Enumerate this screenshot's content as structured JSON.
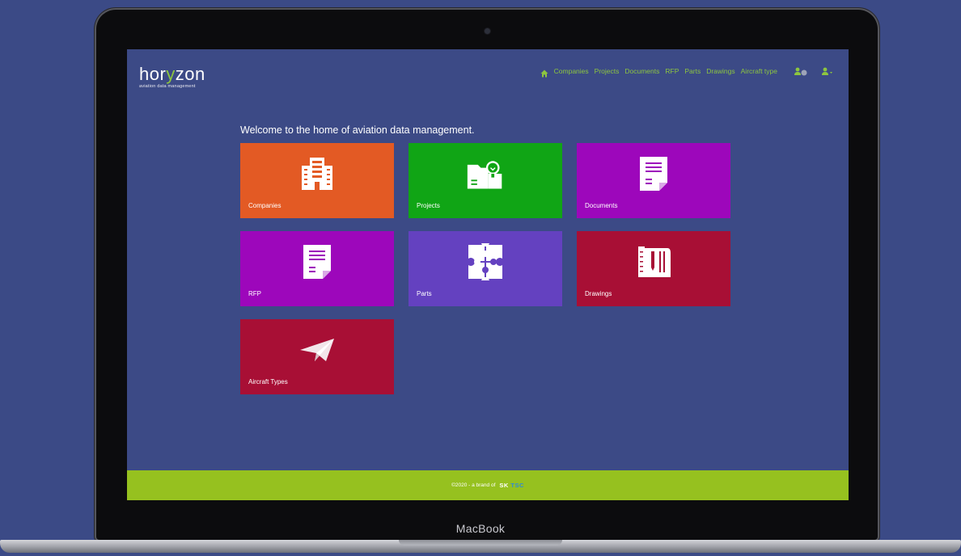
{
  "app": {
    "logo_text_a": "hor",
    "logo_text_y": "y",
    "logo_text_b": "zon",
    "logo_tagline": "aviation data management"
  },
  "nav": {
    "home_icon": "home-icon",
    "items": [
      "Companies",
      "Projects",
      "Documents",
      "RFP",
      "Parts",
      "Drawings",
      "Aircraft type"
    ],
    "notification_icon": "notification-user-icon",
    "account_icon": "user-icon"
  },
  "welcome_text": "Welcome to the home of aviation data management.",
  "tiles": [
    {
      "label": "Companies",
      "color": "#e35a24",
      "icon": "building-icon"
    },
    {
      "label": "Projects",
      "color": "#10a515",
      "icon": "folder-lightbulb-icon"
    },
    {
      "label": "Documents",
      "color": "#9d07bb",
      "icon": "document-icon"
    },
    {
      "label": "RFP",
      "color": "#9d07bb",
      "icon": "document-icon"
    },
    {
      "label": "Parts",
      "color": "#6441c0",
      "icon": "puzzle-icon"
    },
    {
      "label": "Drawings",
      "color": "#a80f35",
      "icon": "blueprint-icon"
    },
    {
      "label": "Aircraft Types",
      "color": "#a80f35",
      "icon": "paper-plane-icon"
    }
  ],
  "footer": {
    "copyright": "©2020 - a brand of",
    "brand_a": "SK",
    "brand_b": "TSC"
  },
  "device_label": "MacBook",
  "colors": {
    "accent": "#8dc63f",
    "page_bg": "#3c4a86",
    "footer_bg": "#96c11f"
  }
}
